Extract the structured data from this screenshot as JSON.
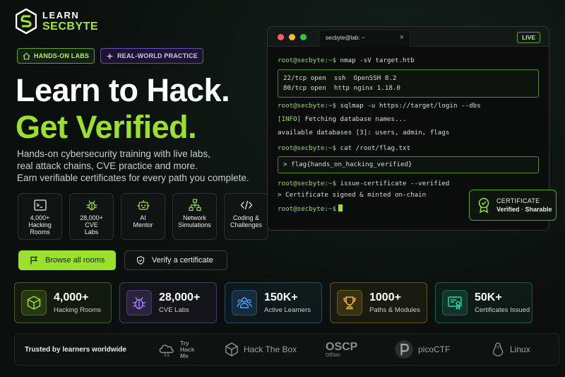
{
  "logo": {
    "line1": "LEARN",
    "line2": "SECBYTE"
  },
  "tags": [
    {
      "label": "HANDS-ON LABS",
      "icon": "home-icon"
    },
    {
      "label": "REAL-WORLD PRACTICE",
      "icon": "sparkle-icon"
    }
  ],
  "hero": {
    "title_line1": "Learn to Hack.",
    "title_line2": "Get Verified.",
    "description": [
      "Hands-on cybersecurity training with live labs,",
      "real attack chains, CVE practice and more.",
      "Earn verifiable certificates for every path you complete."
    ]
  },
  "features": [
    {
      "label": "4,000+\nHacking\nRooms",
      "icon": "terminal-icon"
    },
    {
      "label": "28,000+\nCVE\nLabs",
      "icon": "bug-icon"
    },
    {
      "label": "AI\nMentor",
      "icon": "robot-icon"
    },
    {
      "label": "Network\nSimulations",
      "icon": "network-icon"
    },
    {
      "label": "Coding &\nChallenges",
      "icon": "code-icon"
    }
  ],
  "buttons": {
    "browse": "Browse all rooms",
    "verify": "Verify a certificate"
  },
  "terminal": {
    "tab_title": "secbyte@lab: ~",
    "tab_close": "×",
    "live_badge": "LIVE",
    "prompt": "root@secbyte:~$",
    "cmd1": "nmap -sV target.htb",
    "out1": [
      "22/tcp open  ssh  OpenSSH 8.2",
      "80/tcp open  http nginx 1.18.0"
    ],
    "cmd2": "sqlmap -u https://target/login --dbs",
    "info_tag": "[INFO]",
    "info_text": " Fetching database names...",
    "dbs_line": "available databases [3]: users, admin, flags",
    "cmd3": "cat /root/flag.txt",
    "flag": "> flag{hands_on_hacking_verified}",
    "cmd4": "issue-certificate --verified",
    "signed": ">  Certificate signed & minted on-chain"
  },
  "certificate": {
    "title": "CERTIFICATE",
    "status_a": "Verified",
    "separator": "·",
    "status_b": "Sharable"
  },
  "stats": [
    {
      "value": "4,000+",
      "label": "Hacking Rooms",
      "icon": "cube-icon",
      "accent": "#9be02c"
    },
    {
      "value": "28,000+",
      "label": "CVE Labs",
      "icon": "bug-icon",
      "accent": "#a97cff"
    },
    {
      "value": "150K+",
      "label": "Active Learners",
      "icon": "users-icon",
      "accent": "#4aa3ff"
    },
    {
      "value": "1000+",
      "label": "Paths & Modules",
      "icon": "trophy-icon",
      "accent": "#f0b429"
    },
    {
      "value": "50K+",
      "label": "Certificates Issued",
      "icon": "certificate-icon",
      "accent": "#2dd4a8"
    }
  ],
  "trust": {
    "title": "Trusted by learners worldwide",
    "brands": [
      {
        "name": "TryHackMe",
        "lines": [
          "Try",
          "Hack",
          "Me"
        ],
        "icon": "cloud-icon"
      },
      {
        "name": "Hack The Box",
        "icon": "box-icon"
      },
      {
        "name": "OSCP",
        "sub": "OffSec"
      },
      {
        "name": "picoCTF",
        "icon": "pico-icon"
      },
      {
        "name": "Linux",
        "icon": "penguin-icon"
      }
    ]
  }
}
